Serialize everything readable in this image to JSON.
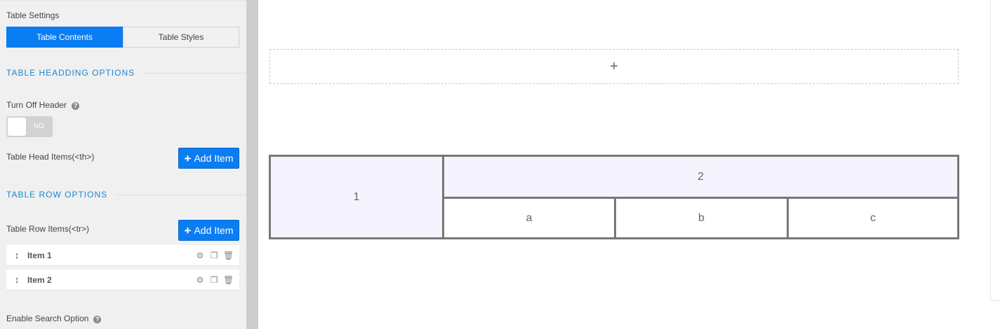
{
  "sidebar": {
    "settings_title": "Table Settings",
    "tabs": [
      {
        "label": "Table Contents",
        "active": true
      },
      {
        "label": "Table Styles",
        "active": false
      }
    ],
    "heading_options": {
      "section_title": "TABLE HEADDING OPTIONS",
      "turn_off_header_label": "Turn Off Header",
      "toggle_state": "NO",
      "head_items_label": "Table Head Items(<th>)",
      "add_item_label": "Add Item"
    },
    "row_options": {
      "section_title": "TABLE ROW OPTIONS",
      "row_items_label": "Table Row Items(<tr>)",
      "add_item_label": "Add Item",
      "items": [
        {
          "label": "Item 1"
        },
        {
          "label": "Item 2"
        }
      ]
    },
    "enable_search_label": "Enable Search Option"
  },
  "canvas": {
    "drop_zone_symbol": "+",
    "table": {
      "header_left": "1",
      "header_right": "2",
      "cells": [
        "a",
        "b",
        "c"
      ]
    }
  },
  "colors": {
    "accent": "#0a7df3",
    "section_title": "#1b88c9",
    "sidebar_bg": "#f0f0f1",
    "table_head_bg": "#f5f4fe"
  }
}
